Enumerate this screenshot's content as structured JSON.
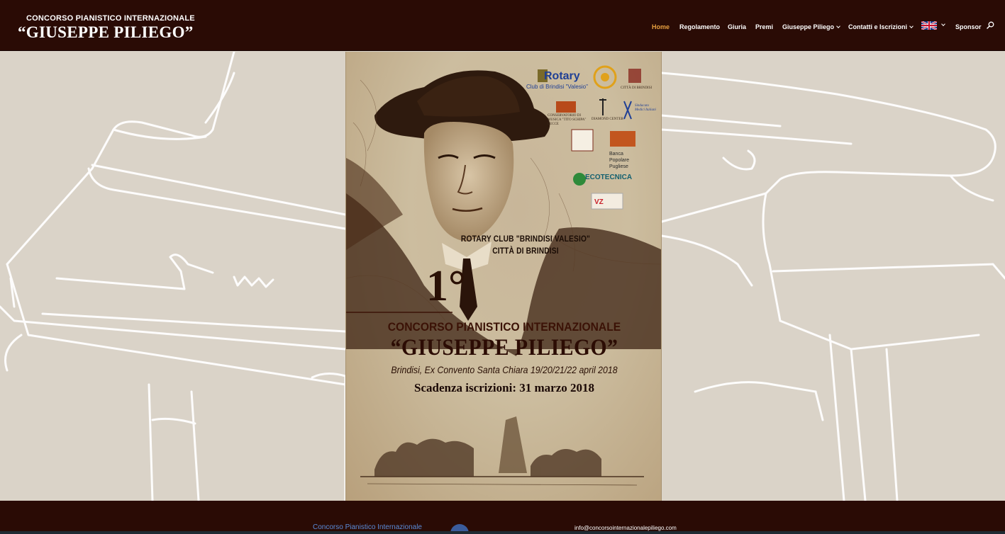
{
  "header": {
    "logo_line1": "CONCORSO PIANISTICO INTERNAZIONALE",
    "logo_line2": "“GIUSEPPE PILIEGO”",
    "nav": [
      {
        "label": "Home",
        "active": true,
        "dropdown": false
      },
      {
        "label": "Regolamento",
        "active": false,
        "dropdown": false
      },
      {
        "label": "Giuria",
        "active": false,
        "dropdown": false
      },
      {
        "label": "Premi",
        "active": false,
        "dropdown": false
      },
      {
        "label": "Giuseppe Piliego",
        "active": false,
        "dropdown": true
      },
      {
        "label": "Contatti e Iscrizioni",
        "active": false,
        "dropdown": true
      },
      {
        "label": "Sponsor",
        "active": false,
        "dropdown": false
      }
    ],
    "language_icon": "uk-flag-icon",
    "search_icon": "search-icon"
  },
  "poster": {
    "rotary_name": "Rotary",
    "rotary_sub": "Club di Brindisi \"Valesio\"",
    "city_label": "CITTÀ di BRINDISI",
    "conservatorio": "CONSERVATORIO di MUSICA \"TITO SCHIPA\" LECCE",
    "diamond": "DIAMOND CENTER",
    "sindacato": "Sindacato Medici Italiani",
    "bpp": "Banca Popolare Pugliese",
    "ecotecnica": "ECOTECNICA",
    "org_line1": "ROTARY CLUB \"BRINDISI VALESIO\"",
    "org_line2": "CITTÀ DI BRINDISI",
    "edition": "1°",
    "title1": "CONCORSO PIANISTICO INTERNAZIONALE",
    "title2": "“GIUSEPPE PILIEGO”",
    "subtitle": "Brindisi, Ex Convento Santa Chiara 19/20/21/22 april 2018",
    "deadline": "Scadenza iscrizioni: 31 marzo 2018"
  },
  "footer": {
    "facebook_link": "Concorso Pianistico Internazionale",
    "email": "info@concorsointernazionalepiliego.com"
  },
  "colors": {
    "header_bg": "#2a0b05",
    "page_bg": "#dad3c8",
    "active_nav": "#e8a040",
    "poster_ink": "#2c0c04"
  }
}
